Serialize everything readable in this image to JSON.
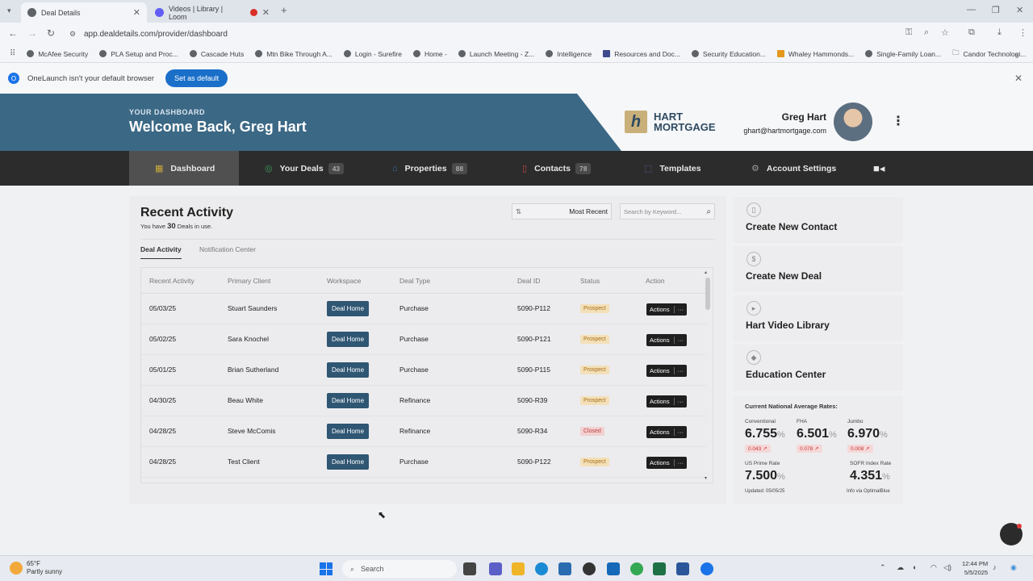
{
  "browser": {
    "tabs": [
      {
        "label": "Deal Details",
        "active": true
      },
      {
        "label": "Videos | Library | Loom",
        "active": false
      }
    ],
    "url": "app.dealdetails.com/provider/dashboard",
    "bookmarks": [
      "McAfee Security",
      "PLA Setup and Proc...",
      "Cascade Huts",
      "Mtn Bike Through A...",
      "Login - Surefire",
      "Home -",
      "Launch Meeting - Z...",
      "Intelligence",
      "Resources and Doc...",
      "Security Education...",
      "Whaley Hammonds...",
      "Single-Family Loan...",
      "Candor Technologi..."
    ],
    "infobar": {
      "message": "OneLaunch isn't your default browser",
      "button": "Set as default"
    }
  },
  "header": {
    "eyebrow": "YOUR DASHBOARD",
    "welcome": "Welcome Back, Greg Hart",
    "logo_line1": "HART",
    "logo_line2": "MORTGAGE",
    "user_name": "Greg Hart",
    "user_email": "ghart@hartmortgage.com"
  },
  "nav": [
    {
      "label": "Dashboard",
      "icon": "grid-icon",
      "count": ""
    },
    {
      "label": "Your Deals",
      "icon": "dollar-icon",
      "count": "43"
    },
    {
      "label": "Properties",
      "icon": "home-icon",
      "count": "88"
    },
    {
      "label": "Contacts",
      "icon": "contact-icon",
      "count": "78"
    },
    {
      "label": "Templates",
      "icon": "template-icon",
      "count": ""
    },
    {
      "label": "Account Settings",
      "icon": "gear-icon",
      "count": ""
    }
  ],
  "activity": {
    "title": "Recent Activity",
    "sub_pre": "You have",
    "sub_count": "30",
    "sub_post": "Deals in use.",
    "filter": "Most Recent",
    "search_placeholder": "Search by Keyword...",
    "tabs": [
      "Deal Activity",
      "Notification Center"
    ],
    "columns": [
      "Recent Activity",
      "Primary Client",
      "Workspace",
      "Deal Type",
      "Deal ID",
      "Status",
      "Action"
    ],
    "workspace_label": "Deal Home",
    "action_label": "Actions",
    "rows": [
      {
        "date": "05/03/25",
        "client": "Stuart Saunders",
        "type": "Purchase",
        "id": "5090-P112",
        "status": "Prospect"
      },
      {
        "date": "05/02/25",
        "client": "Sara Knochel",
        "type": "Purchase",
        "id": "5090-P121",
        "status": "Prospect"
      },
      {
        "date": "05/01/25",
        "client": "Brian Sutherland",
        "type": "Purchase",
        "id": "5090-P115",
        "status": "Prospect"
      },
      {
        "date": "04/30/25",
        "client": "Beau White",
        "type": "Refinance",
        "id": "5090-R39",
        "status": "Prospect"
      },
      {
        "date": "04/28/25",
        "client": "Steve McComis",
        "type": "Refinance",
        "id": "5090-R34",
        "status": "Closed"
      },
      {
        "date": "04/28/25",
        "client": "Test Client",
        "type": "Purchase",
        "id": "5090-P122",
        "status": "Prospect"
      }
    ]
  },
  "sidebar": {
    "cards": [
      "Create New Contact",
      "Create New Deal",
      "Hart Video Library",
      "Education Center"
    ],
    "rates_title": "Current National Average Rates:",
    "rates": [
      {
        "label": "Conventional",
        "value": "6.755",
        "change": "0.043 ↗"
      },
      {
        "label": "FHA",
        "value": "6.501",
        "change": "0.078 ↗"
      },
      {
        "label": "Jumbo",
        "value": "6.970",
        "change": "0.008 ↗"
      },
      {
        "label": "US Prime Rate",
        "value": "7.500",
        "change": ""
      },
      {
        "label": "SOFR Index Rate",
        "value": "4.351",
        "change": ""
      }
    ],
    "percent": "%",
    "updated": "Updated: 05/05/25",
    "source": "Info via OptimalBlue"
  },
  "taskbar": {
    "temp": "65°F",
    "weather": "Partly sunny",
    "search": "Search",
    "time": "12:44 PM",
    "date": "5/5/2025"
  }
}
